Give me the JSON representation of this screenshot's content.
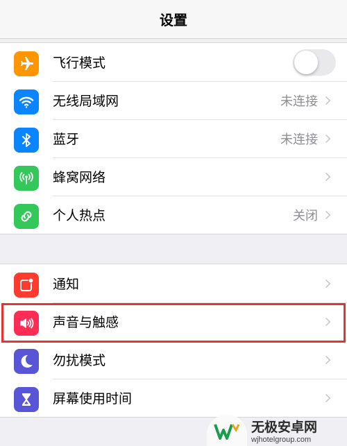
{
  "header": {
    "title": "设置"
  },
  "group1": {
    "airplane": {
      "label": "飞行模式",
      "icon": "airplane-icon",
      "color": "#ff9500",
      "toggle": "off"
    },
    "wifi": {
      "label": "无线局域网",
      "detail": "未连接",
      "icon": "wifi-icon",
      "color": "#0a84ff"
    },
    "bluetooth": {
      "label": "蓝牙",
      "detail": "未连接",
      "icon": "bluetooth-icon",
      "color": "#0a84ff"
    },
    "cellular": {
      "label": "蜂窝网络",
      "icon": "cellular-antenna-icon",
      "color": "#34c759"
    },
    "hotspot": {
      "label": "个人热点",
      "detail": "关闭",
      "icon": "hotspot-link-icon",
      "color": "#34c759"
    }
  },
  "group2": {
    "notifications": {
      "label": "通知",
      "icon": "notification-icon",
      "color": "#ff3b30"
    },
    "sounds": {
      "label": "声音与触感",
      "icon": "speaker-icon",
      "color": "#ff2d55",
      "highlighted": true
    },
    "dnd": {
      "label": "勿扰模式",
      "icon": "moon-icon",
      "color": "#5856d6"
    },
    "screentime": {
      "label": "屏幕使用时间",
      "icon": "hourglass-icon",
      "color": "#5856d6"
    }
  },
  "watermark": {
    "main": "无极安卓网",
    "sub": "wjhotelgroup.com",
    "icon": "w-logo-icon"
  },
  "colors": {
    "highlight": "#e8322f",
    "chevron": "#c7c7cc"
  }
}
